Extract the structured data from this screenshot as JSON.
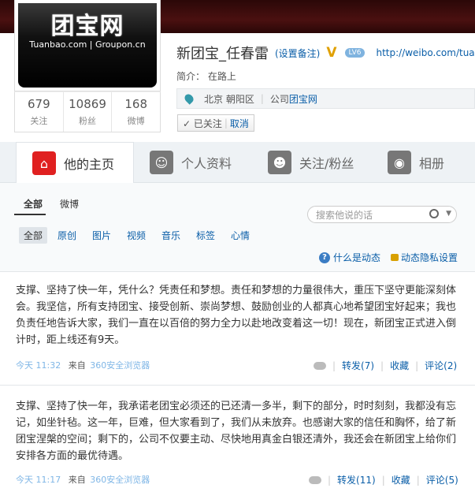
{
  "profile": {
    "logo_cn": "团宝网",
    "logo_en": "Tuanbao.com | Groupon.cn",
    "stats": [
      {
        "num": "679",
        "label": "关注"
      },
      {
        "num": "10869",
        "label": "粉丝"
      },
      {
        "num": "168",
        "label": "微博"
      }
    ],
    "name": "新团宝_任春雷",
    "remark": "(设置备注)",
    "verified": "V",
    "level": "LV6",
    "blog_url": "http://weibo.com/tua",
    "intro_label": "简介：",
    "intro": "在路上",
    "location": "北京 朝阳区",
    "company_label": "公司",
    "company": "团宝网",
    "followed": "✓ 已关注",
    "cancel": "取消"
  },
  "tabs": [
    {
      "label": "他的主页",
      "icon": "home-icon"
    },
    {
      "label": "个人资料",
      "icon": "user-icon"
    },
    {
      "label": "关注/粉丝",
      "icon": "users-icon"
    },
    {
      "label": "相册",
      "icon": "camera-icon"
    }
  ],
  "filters": {
    "primary": [
      "全部",
      "微博"
    ],
    "search_placeholder": "搜索他说的话",
    "secondary": [
      "全部",
      "原创",
      "图片",
      "视频",
      "音乐",
      "标签",
      "心情"
    ],
    "help": "什么是动态",
    "privacy": "动态隐私设置"
  },
  "posts": [
    {
      "text": "支撑、坚持了快一年，凭什么？凭责任和梦想。责任和梦想的力量很伟大，重压下坚守更能深刻体会。我坚信，所有支持团宝、接受创新、崇尚梦想、鼓励创业的人都真心地希望团宝好起来；我也负责任地告诉大家，我们一直在以百倍的努力全力以赴地改变着这一切！现在，新团宝正式进入倒计时，距上线还有9天。",
      "time": "今天 11:32",
      "from": "来自",
      "source": "360安全浏览器",
      "repost": "转发(7)",
      "fav": "收藏",
      "comment": "评论(2)"
    },
    {
      "text": "支撑、坚持了快一年，我承诺老团宝必须还的已还清一多半，剩下的部分，时时刻刻，我都没有忘记，如坐针毡。这一年，巨难，但大家看到了，我们从未放弃。也感谢大家的信任和胸怀，给了新团宝涅槃的空间；剩下的，公司不仅要主动、尽快地用真金白银还清外，我还会在新团宝上给你们安排各方面的最优待遇。",
      "time": "今天 11:17",
      "from": "来自",
      "source": "360安全浏览器",
      "repost": "转发(11)",
      "fav": "收藏",
      "comment": "评论(5)"
    }
  ]
}
